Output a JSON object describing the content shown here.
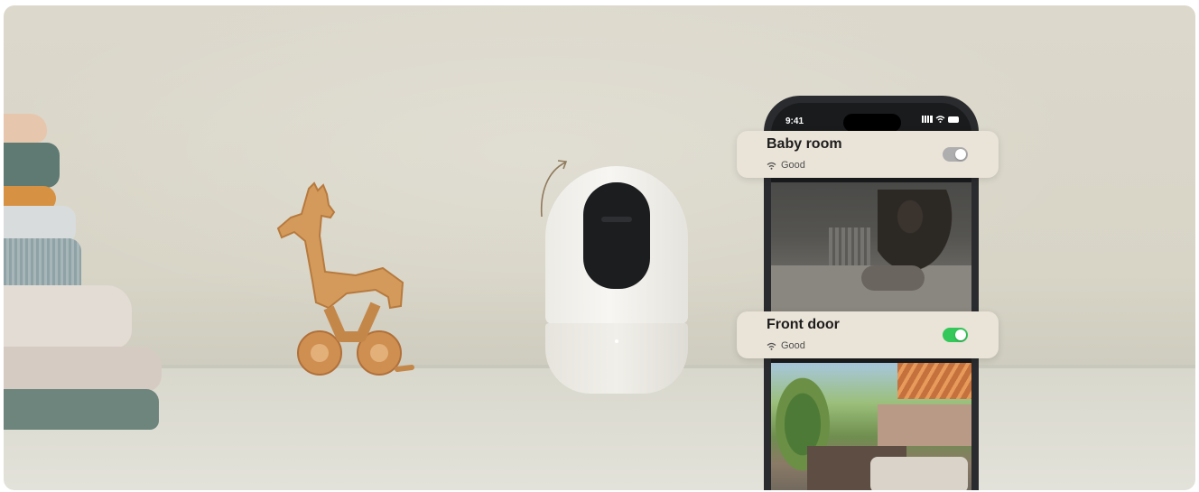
{
  "phone": {
    "status_time": "9:41"
  },
  "cameras": [
    {
      "name": "Baby room",
      "status": "Good",
      "enabled": false
    },
    {
      "name": "Front door",
      "status": "Good",
      "enabled": true
    }
  ],
  "colors": {
    "toggle_on": "#34c759",
    "toggle_off": "#aeaeae",
    "card_bg": "#eae3d8"
  },
  "icons": [
    "wifi-icon",
    "signal-icon",
    "battery-icon",
    "rotate-arrow-icon"
  ]
}
